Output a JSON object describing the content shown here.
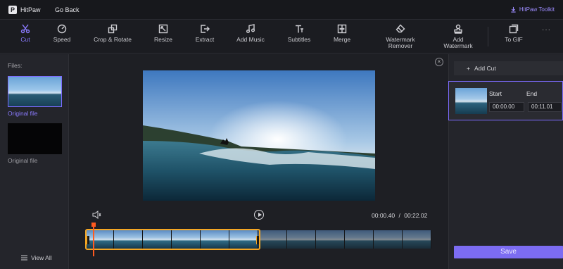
{
  "app": {
    "name": "HitPaw",
    "go_back": "Go Back",
    "toolkit": "HitPaw Toolkit"
  },
  "toolbar": {
    "items": [
      {
        "label": "Cut",
        "icon": "scissors-icon",
        "active": true
      },
      {
        "label": "Speed",
        "icon": "speedometer-icon"
      },
      {
        "label": "Crop & Rotate",
        "icon": "crop-rotate-icon"
      },
      {
        "label": "Resize",
        "icon": "resize-icon"
      },
      {
        "label": "Extract",
        "icon": "extract-icon"
      },
      {
        "label": "Add Music",
        "icon": "music-note-icon"
      },
      {
        "label": "Subtitles",
        "icon": "text-icon"
      },
      {
        "label": "Merge",
        "icon": "merge-icon"
      },
      {
        "label": "Watermark Remover",
        "icon": "eraser-icon"
      },
      {
        "label": "Add Watermark",
        "icon": "stamp-icon"
      },
      {
        "label": "To GIF",
        "icon": "gif-icon"
      }
    ],
    "more": "···"
  },
  "files": {
    "label": "Files:",
    "items": [
      {
        "label": "Original file",
        "selected": true
      },
      {
        "label": "Original file",
        "selected": false
      }
    ],
    "view_all": "View All"
  },
  "player": {
    "current_time": "00:00.40",
    "separator": "/",
    "total_time": "00:22.02"
  },
  "cuts": {
    "add_label": "Add Cut",
    "start_label": "Start",
    "end_label": "End",
    "start_value": "00:00.00",
    "end_value": "00:11.01"
  },
  "save_label": "Save",
  "colors": {
    "accent": "#7c6cf2",
    "selection": "#f5a623",
    "playhead": "#ff5a1f"
  }
}
